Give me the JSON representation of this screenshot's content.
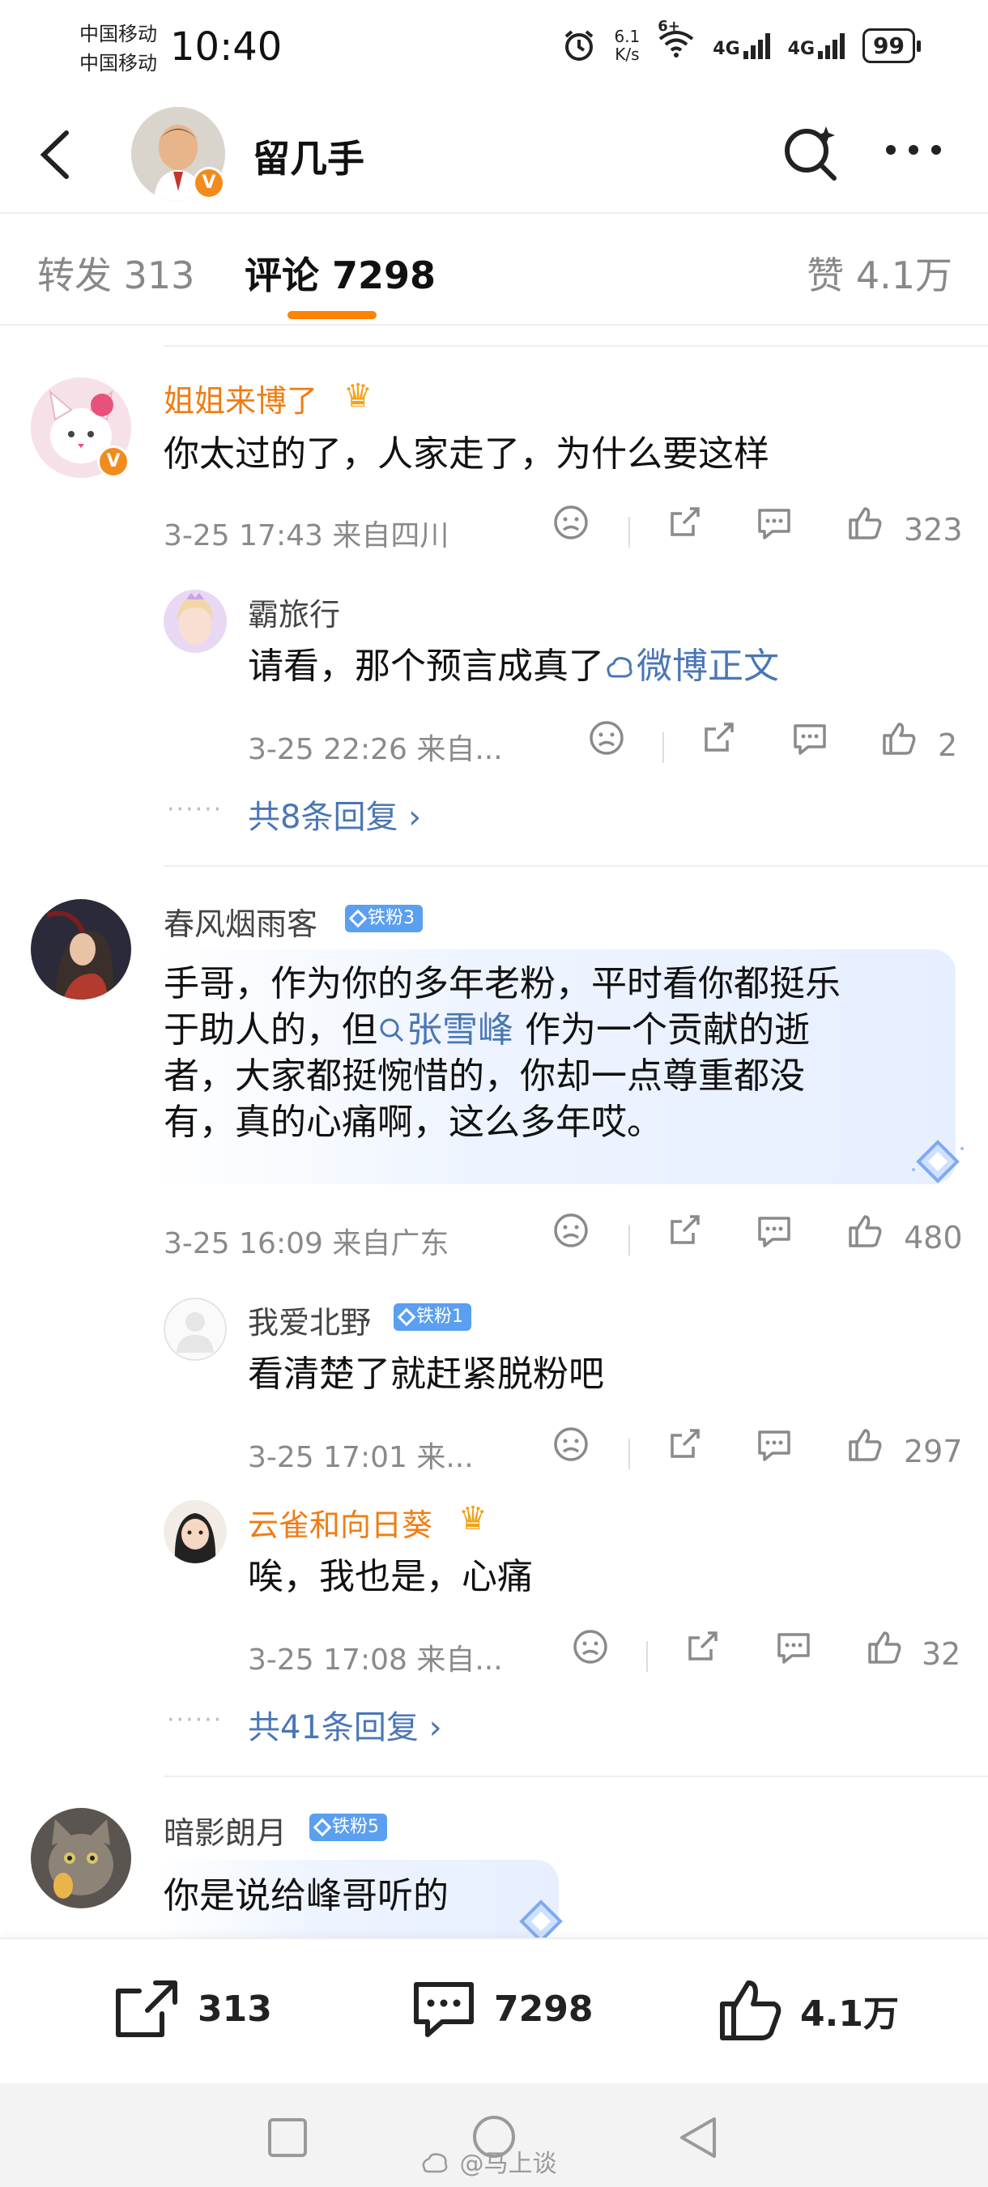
{
  "status_bar": {
    "carrier1": "中国移动",
    "carrier2": "中国移动",
    "time": "10:40",
    "speed_value": "6.1",
    "speed_unit": "K/s",
    "wifi_label": "6+",
    "net1": "4G",
    "net2": "4G",
    "battery": "99"
  },
  "header": {
    "username": "留几手",
    "verified_badge": "V"
  },
  "tabs": [
    {
      "label": "转发 313"
    },
    {
      "label": "评论 7298"
    },
    {
      "label": "赞 4.1万"
    }
  ],
  "comments": [
    {
      "user": "姐姐来博了",
      "text": "你太过的了，人家走了，为什么要这样",
      "meta": "3-25 17:43  来自四川",
      "likes": "323",
      "replies": [
        {
          "user": "霸旅行",
          "text_prefix": "请看，那个预言成真了",
          "link": "微博正文",
          "meta": "3-25 22:26  来自...",
          "likes": "2"
        }
      ],
      "more_replies": "共8条回复 ›"
    },
    {
      "user": "春风烟雨客",
      "badge": "铁粉3",
      "text_line1": "手哥，作为你的多年老粉，平时看你都挺乐",
      "text_line2a": "于助人的，但",
      "mention": "张雪峰",
      "text_line2b": " 作为一个贡献的逝",
      "text_line3": "者，大家都挺惋惜的，你却一点尊重都没",
      "text_line4": "有，真的心痛啊，这么多年哎。",
      "meta": "3-25 16:09  来自广东",
      "likes": "480",
      "replies": [
        {
          "user": "我爱北野",
          "badge": "铁粉1",
          "text": "看清楚了就赶紧脱粉吧",
          "meta": "3-25 17:01  来...",
          "likes": "297"
        },
        {
          "user": "云雀和向日葵",
          "text": "唉，我也是，心痛",
          "meta": "3-25 17:08  来自...",
          "likes": "32"
        }
      ],
      "more_replies": "共41条回复 ›"
    },
    {
      "user": "暗影朗月",
      "badge": "铁粉5",
      "text": "你是说给峰哥听的"
    }
  ],
  "bottom_bar": {
    "repost_count": "313",
    "comment_count": "7298",
    "like_count": "4.1万"
  },
  "watermark": "@马上谈",
  "colors": {
    "accent": "#ff8200",
    "link": "#4a76b6",
    "vip_name": "#f07c14",
    "fan_badge": "#5a9ff0"
  }
}
